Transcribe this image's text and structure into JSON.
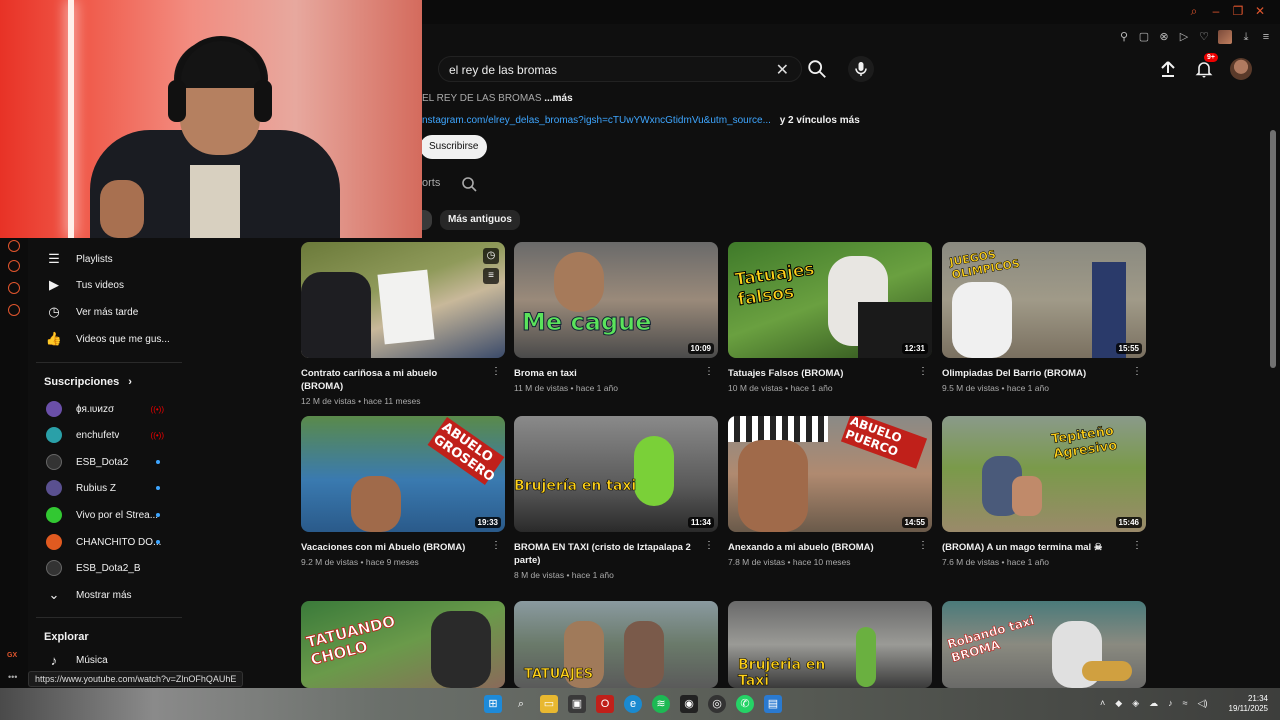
{
  "search": {
    "query": "el rey de las bromas"
  },
  "header": {
    "notif_badge": "9+"
  },
  "channel": {
    "desc_text": "EL REY DE LAS BROMAS",
    "desc_more": "...más",
    "link": "nstagram.com/elrey_delas_bromas?igsh=cTUwYWxncGtidmVu&utm_source...",
    "link_more": "y 2 vínculos más",
    "subscribe": "Suscribirse",
    "tab_shorts": "orts",
    "chip_oldest": "Más antiguos"
  },
  "sidebar": {
    "items": [
      {
        "label": "Playlists",
        "icon": "playlist-icon"
      },
      {
        "label": "Tus videos",
        "icon": "video-icon"
      },
      {
        "label": "Ver más tarde",
        "icon": "clock-icon"
      },
      {
        "label": "Videos que me gus...",
        "icon": "thumbs-up-icon"
      }
    ],
    "subs_title": "Suscripciones",
    "subs": [
      {
        "label": "ɸя.ιυиzσ",
        "live": true,
        "color": "#6a4fa8"
      },
      {
        "label": "enchufetv",
        "live": true,
        "color": "#2aa0a8"
      },
      {
        "label": "ESB_Dota2",
        "dot": true,
        "color": "#333333"
      },
      {
        "label": "Rubius Z",
        "dot": true,
        "color": "#5a5090"
      },
      {
        "label": "Vivo por el Strea...",
        "dot": true,
        "color": "#32c832"
      },
      {
        "label": "CHANCHITO DO...",
        "dot": true,
        "color": "#e05a20"
      },
      {
        "label": "ESB_Dota2_B",
        "dot": true,
        "color": "#333333"
      }
    ],
    "show_more": "Mostrar más",
    "explore_title": "Explorar",
    "music": "Música"
  },
  "videos": [
    {
      "title": "Contrato cariñosa a mi abuelo (BROMA)",
      "views": "12 M de vistas",
      "age": "hace 11 meses",
      "duration": "",
      "overlay": ""
    },
    {
      "title": "Broma en taxi",
      "views": "11 M de vistas",
      "age": "hace 1 año",
      "duration": "10:09",
      "overlay": "Me cague"
    },
    {
      "title": "Tatuajes Falsos (BROMA)",
      "views": "10 M de vistas",
      "age": "hace 1 año",
      "duration": "12:31",
      "overlay": "Tatuajes falsos"
    },
    {
      "title": "Olimpiadas Del Barrio (BROMA)",
      "views": "9.5 M de vistas",
      "age": "hace 1 año",
      "duration": "15:55",
      "overlay": "JUEGOS OLIMPICOS"
    },
    {
      "title": "Vacaciones con mi Abuelo (BROMA)",
      "views": "9.2 M de vistas",
      "age": "hace 9 meses",
      "duration": "19:33",
      "overlay": "ABUELO GROSERO"
    },
    {
      "title": "BROMA EN TAXI (cristo de Iztapalapa 2 parte)",
      "views": "8 M de vistas",
      "age": "hace 1 año",
      "duration": "11:34",
      "overlay": "Brujería en taxi"
    },
    {
      "title": "Anexando a mi abuelo (BROMA)",
      "views": "7.8 M de vistas",
      "age": "hace 10 meses",
      "duration": "14:55",
      "overlay": "ABUELO PUERCO"
    },
    {
      "title": "(BROMA) A un mago termina mal ☠",
      "views": "7.6 M de vistas",
      "age": "hace 1 año",
      "duration": "15:46",
      "overlay": "Tepiteño Agresivo"
    },
    {
      "overlay": "TATUANDO CHOLO"
    },
    {
      "overlay": "TATUAJES"
    },
    {
      "overlay": "Brujeria en Taxi"
    },
    {
      "overlay": "Robando taxi BROMA"
    }
  ],
  "status_url": "https://www.youtube.com/watch?v=ZlnOFhQAUhE",
  "gx_label": "GX",
  "clock": {
    "time": "21:34",
    "date": "19/11/2025"
  }
}
